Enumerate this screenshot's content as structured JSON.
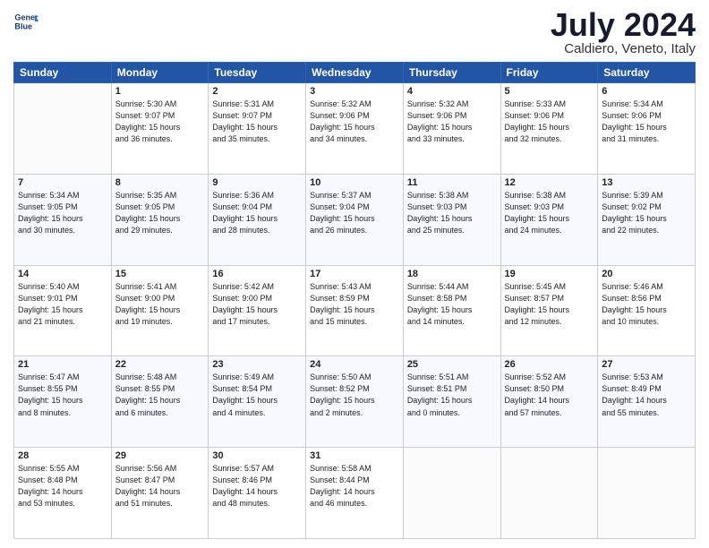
{
  "header": {
    "logo_line1": "General",
    "logo_line2": "Blue",
    "title": "July 2024",
    "location": "Caldiero, Veneto, Italy"
  },
  "weekdays": [
    "Sunday",
    "Monday",
    "Tuesday",
    "Wednesday",
    "Thursday",
    "Friday",
    "Saturday"
  ],
  "weeks": [
    [
      {
        "day": "",
        "info": ""
      },
      {
        "day": "1",
        "info": "Sunrise: 5:30 AM\nSunset: 9:07 PM\nDaylight: 15 hours\nand 36 minutes."
      },
      {
        "day": "2",
        "info": "Sunrise: 5:31 AM\nSunset: 9:07 PM\nDaylight: 15 hours\nand 35 minutes."
      },
      {
        "day": "3",
        "info": "Sunrise: 5:32 AM\nSunset: 9:06 PM\nDaylight: 15 hours\nand 34 minutes."
      },
      {
        "day": "4",
        "info": "Sunrise: 5:32 AM\nSunset: 9:06 PM\nDaylight: 15 hours\nand 33 minutes."
      },
      {
        "day": "5",
        "info": "Sunrise: 5:33 AM\nSunset: 9:06 PM\nDaylight: 15 hours\nand 32 minutes."
      },
      {
        "day": "6",
        "info": "Sunrise: 5:34 AM\nSunset: 9:06 PM\nDaylight: 15 hours\nand 31 minutes."
      }
    ],
    [
      {
        "day": "7",
        "info": "Sunrise: 5:34 AM\nSunset: 9:05 PM\nDaylight: 15 hours\nand 30 minutes."
      },
      {
        "day": "8",
        "info": "Sunrise: 5:35 AM\nSunset: 9:05 PM\nDaylight: 15 hours\nand 29 minutes."
      },
      {
        "day": "9",
        "info": "Sunrise: 5:36 AM\nSunset: 9:04 PM\nDaylight: 15 hours\nand 28 minutes."
      },
      {
        "day": "10",
        "info": "Sunrise: 5:37 AM\nSunset: 9:04 PM\nDaylight: 15 hours\nand 26 minutes."
      },
      {
        "day": "11",
        "info": "Sunrise: 5:38 AM\nSunset: 9:03 PM\nDaylight: 15 hours\nand 25 minutes."
      },
      {
        "day": "12",
        "info": "Sunrise: 5:38 AM\nSunset: 9:03 PM\nDaylight: 15 hours\nand 24 minutes."
      },
      {
        "day": "13",
        "info": "Sunrise: 5:39 AM\nSunset: 9:02 PM\nDaylight: 15 hours\nand 22 minutes."
      }
    ],
    [
      {
        "day": "14",
        "info": "Sunrise: 5:40 AM\nSunset: 9:01 PM\nDaylight: 15 hours\nand 21 minutes."
      },
      {
        "day": "15",
        "info": "Sunrise: 5:41 AM\nSunset: 9:00 PM\nDaylight: 15 hours\nand 19 minutes."
      },
      {
        "day": "16",
        "info": "Sunrise: 5:42 AM\nSunset: 9:00 PM\nDaylight: 15 hours\nand 17 minutes."
      },
      {
        "day": "17",
        "info": "Sunrise: 5:43 AM\nSunset: 8:59 PM\nDaylight: 15 hours\nand 15 minutes."
      },
      {
        "day": "18",
        "info": "Sunrise: 5:44 AM\nSunset: 8:58 PM\nDaylight: 15 hours\nand 14 minutes."
      },
      {
        "day": "19",
        "info": "Sunrise: 5:45 AM\nSunset: 8:57 PM\nDaylight: 15 hours\nand 12 minutes."
      },
      {
        "day": "20",
        "info": "Sunrise: 5:46 AM\nSunset: 8:56 PM\nDaylight: 15 hours\nand 10 minutes."
      }
    ],
    [
      {
        "day": "21",
        "info": "Sunrise: 5:47 AM\nSunset: 8:55 PM\nDaylight: 15 hours\nand 8 minutes."
      },
      {
        "day": "22",
        "info": "Sunrise: 5:48 AM\nSunset: 8:55 PM\nDaylight: 15 hours\nand 6 minutes."
      },
      {
        "day": "23",
        "info": "Sunrise: 5:49 AM\nSunset: 8:54 PM\nDaylight: 15 hours\nand 4 minutes."
      },
      {
        "day": "24",
        "info": "Sunrise: 5:50 AM\nSunset: 8:52 PM\nDaylight: 15 hours\nand 2 minutes."
      },
      {
        "day": "25",
        "info": "Sunrise: 5:51 AM\nSunset: 8:51 PM\nDaylight: 15 hours\nand 0 minutes."
      },
      {
        "day": "26",
        "info": "Sunrise: 5:52 AM\nSunset: 8:50 PM\nDaylight: 14 hours\nand 57 minutes."
      },
      {
        "day": "27",
        "info": "Sunrise: 5:53 AM\nSunset: 8:49 PM\nDaylight: 14 hours\nand 55 minutes."
      }
    ],
    [
      {
        "day": "28",
        "info": "Sunrise: 5:55 AM\nSunset: 8:48 PM\nDaylight: 14 hours\nand 53 minutes."
      },
      {
        "day": "29",
        "info": "Sunrise: 5:56 AM\nSunset: 8:47 PM\nDaylight: 14 hours\nand 51 minutes."
      },
      {
        "day": "30",
        "info": "Sunrise: 5:57 AM\nSunset: 8:46 PM\nDaylight: 14 hours\nand 48 minutes."
      },
      {
        "day": "31",
        "info": "Sunrise: 5:58 AM\nSunset: 8:44 PM\nDaylight: 14 hours\nand 46 minutes."
      },
      {
        "day": "",
        "info": ""
      },
      {
        "day": "",
        "info": ""
      },
      {
        "day": "",
        "info": ""
      }
    ]
  ]
}
